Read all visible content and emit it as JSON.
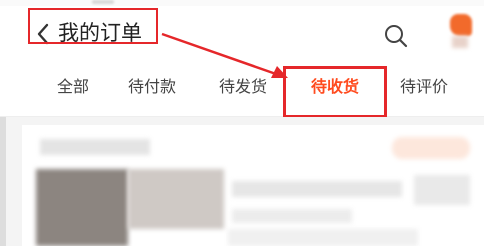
{
  "header": {
    "title": "我的订单",
    "back_icon": "chevron-left-icon",
    "search_icon": "search-icon"
  },
  "tabs": [
    {
      "label": "全部",
      "active": false
    },
    {
      "label": "待付款",
      "active": false
    },
    {
      "label": "待发货",
      "active": false
    },
    {
      "label": "待收货",
      "active": true
    },
    {
      "label": "待评价",
      "active": false
    }
  ],
  "colors": {
    "active_tab": "#ff4b1f",
    "annotation": "#e5272a",
    "text": "#222222",
    "background": "#f4f4f4"
  }
}
